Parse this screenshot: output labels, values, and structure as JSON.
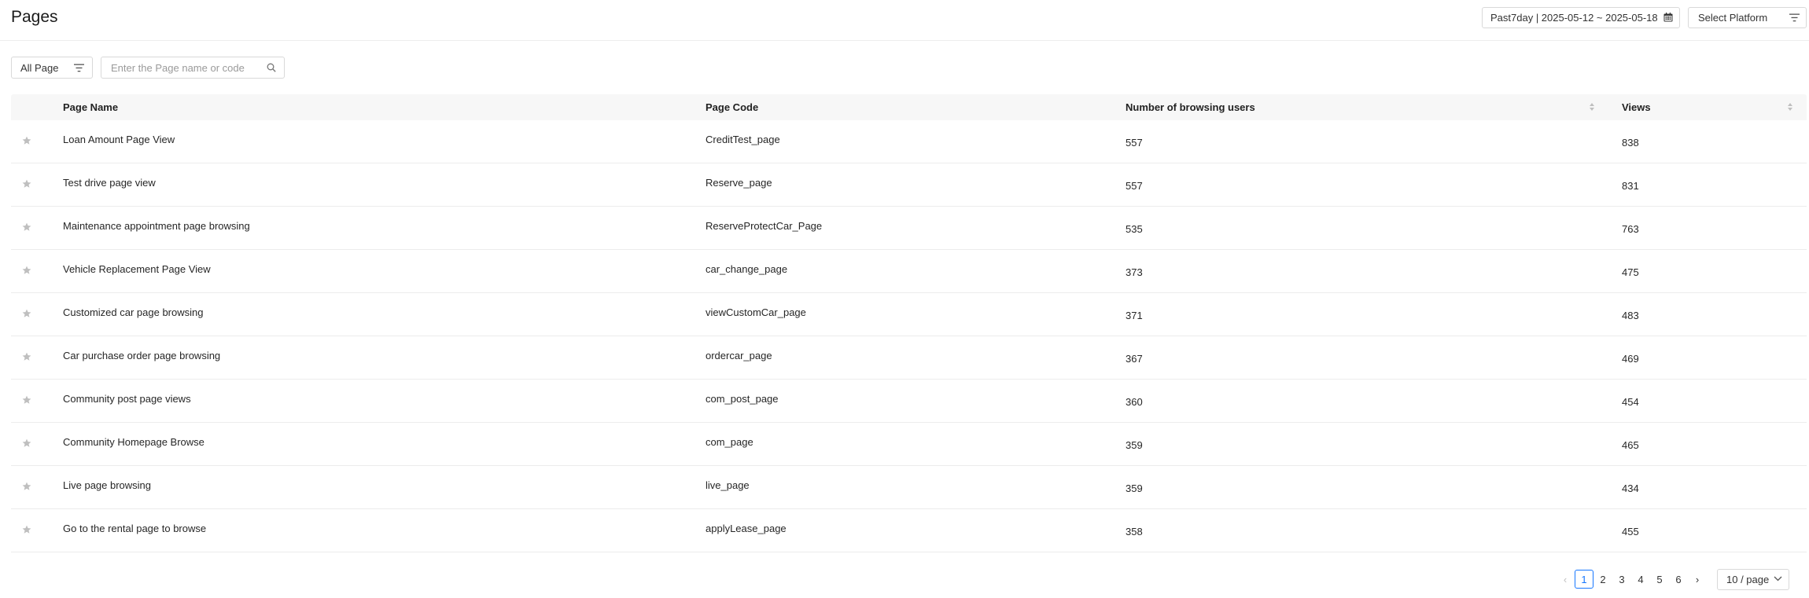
{
  "header": {
    "title": "Pages",
    "date_range": "Past7day | 2025-05-12 ~ 2025-05-18",
    "platform_placeholder": "Select Platform"
  },
  "toolbar": {
    "filter_label": "All Page",
    "search_placeholder": "Enter the Page name or code"
  },
  "table": {
    "columns": [
      "Page Name",
      "Page Code",
      "Number of browsing users",
      "Views"
    ],
    "rows": [
      {
        "name": "Loan Amount Page View",
        "code": "CreditTest_page",
        "users": "557",
        "views": "838"
      },
      {
        "name": "Test drive page view",
        "code": "Reserve_page",
        "users": "557",
        "views": "831"
      },
      {
        "name": "Maintenance appointment page browsing",
        "code": "ReserveProtectCar_Page",
        "users": "535",
        "views": "763"
      },
      {
        "name": "Vehicle Replacement Page View",
        "code": "car_change_page",
        "users": "373",
        "views": "475"
      },
      {
        "name": "Customized car page browsing",
        "code": "viewCustomCar_page",
        "users": "371",
        "views": "483"
      },
      {
        "name": "Car purchase order page browsing",
        "code": "ordercar_page",
        "users": "367",
        "views": "469"
      },
      {
        "name": "Community post page views",
        "code": "com_post_page",
        "users": "360",
        "views": "454"
      },
      {
        "name": "Community Homepage Browse",
        "code": "com_page",
        "users": "359",
        "views": "465"
      },
      {
        "name": "Live page browsing",
        "code": "live_page",
        "users": "359",
        "views": "434"
      },
      {
        "name": "Go to the rental page to browse",
        "code": "applyLease_page",
        "users": "358",
        "views": "455"
      }
    ]
  },
  "pagination": {
    "pages": [
      "1",
      "2",
      "3",
      "4",
      "5",
      "6"
    ],
    "current": "1",
    "page_size": "10 / page"
  },
  "colors": {
    "accent": "#1677ff",
    "border": "#d9d9d9",
    "header_bg": "#f7f7f7",
    "star": "#bfbfbf"
  },
  "icons": {
    "calendar": "calendar-icon",
    "filter": "filter-icon",
    "search": "search-icon",
    "star": "star-icon",
    "sort": "sort-icon",
    "prev": "chevron-left-icon",
    "next": "chevron-right-icon",
    "dropdown": "chevron-down-icon"
  }
}
